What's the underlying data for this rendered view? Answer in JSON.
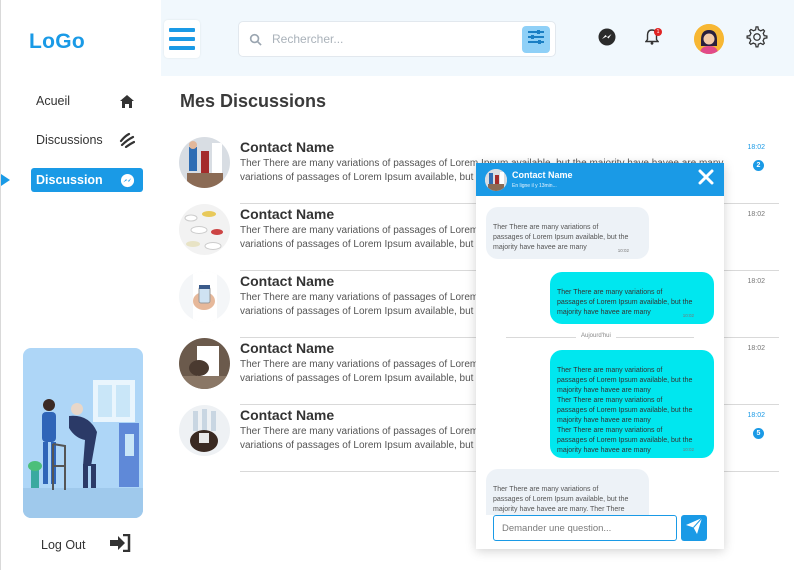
{
  "brand": {
    "logo": "LoGo"
  },
  "sidebar": {
    "items": [
      {
        "label": "Acueil",
        "icon": "home-icon"
      },
      {
        "label": "Discussions",
        "icon": "wave-icon"
      },
      {
        "label": "Discussion",
        "icon": "messenger-icon",
        "active": true
      }
    ],
    "logout_label": "Log Out"
  },
  "header": {
    "search_placeholder": "Rechercher..."
  },
  "main": {
    "title": "Mes Discussions",
    "conversations": [
      {
        "name": "Contact Name",
        "message": "Ther There are many variations of passages of Lorem Ipsum available, but the majority have havee are many\nvariations of passages of Lorem Ipsum available, but the majority have havee are many",
        "time": "18:02",
        "unread": "2",
        "highlight": true
      },
      {
        "name": "Contact Name",
        "message": "Ther There are many variations of passages of Lorem Ipsum available, but the majority have havee are many\nvariations of passages of Lorem Ipsum available, but the majority have havee are many",
        "time": "18:02",
        "unread": "",
        "highlight": false
      },
      {
        "name": "Contact Name",
        "message": "Ther There are many variations of passages of Lorem Ipsum available, but the majority have havee are many\nvariations of passages of Lorem Ipsum available, but the majority have havee are many",
        "time": "18:02",
        "unread": "",
        "highlight": false
      },
      {
        "name": "Contact Name",
        "message": "Ther There are many variations of passages of Lorem Ipsum available, but the majority have havee are many\nvariations of passages of Lorem Ipsum available, but the majority have havee are many",
        "time": "18:02",
        "unread": "",
        "highlight": false
      },
      {
        "name": "Contact Name",
        "message": "Ther There are many variations of passages of Lorem Ipsum available, but the majority have havee are many\nvariations of passages of Lorem Ipsum available, but the majority have havee are many",
        "time": "18:02",
        "unread": "5",
        "highlight": true
      }
    ]
  },
  "chat": {
    "contact_name": "Contact Name",
    "status": "En ligne il y 13min...",
    "messages": [
      {
        "direction": "in",
        "text": "Ther There are many variations of\npassages of Lorem Ipsum available, but the\nmajority have havee are many",
        "time": "10:02"
      },
      {
        "direction": "out",
        "text": "Ther There are many variations of\npassages of Lorem Ipsum available, but the\nmajority have havee are many",
        "time": "10:02"
      },
      {
        "direction": "out",
        "text": "Ther There are many variations of\npassages of Lorem Ipsum available, but the\nmajority have havee are many\nTher There are many variations of\npassages of Lorem Ipsum available, but the\nmajority have havee are many\nTher There are many variations of\npassages of Lorem Ipsum available, but the\nmajority have havee are many",
        "time": "10:02"
      },
      {
        "direction": "in",
        "text": "Ther There are many variations of\npassages of Lorem Ipsum available, but the\nmajority have havee are many. Ther There\nare many variations of passages of Lorem",
        "time": ""
      }
    ],
    "day_separator": "Aujourd'hui",
    "input_placeholder": "Demander une question..."
  },
  "colors": {
    "accent": "#1a9ae6",
    "bubble_out": "#00e7ef",
    "bubble_in": "#edf2f7",
    "header_bg": "#f1f8fd"
  }
}
